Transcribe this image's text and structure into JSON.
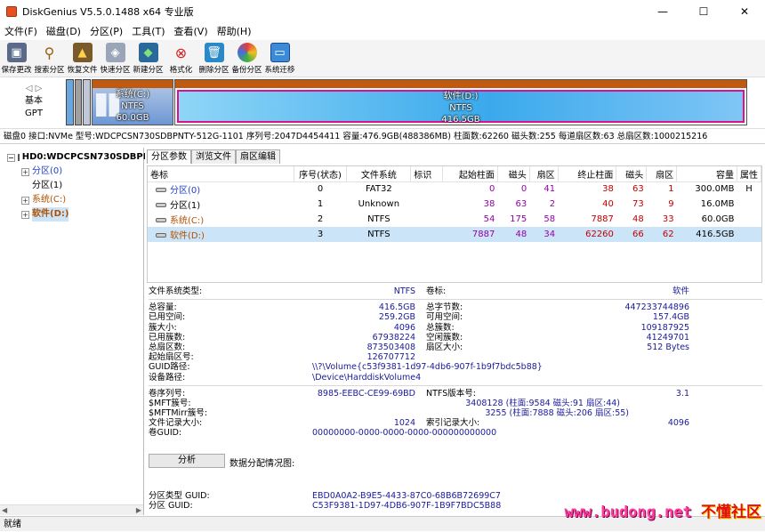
{
  "window": {
    "title": "DiskGenius V5.5.0.1488 x64 专业版",
    "min": "—",
    "max": "☐",
    "close": "✕"
  },
  "menu": [
    "文件(F)",
    "磁盘(D)",
    "分区(P)",
    "工具(T)",
    "查看(V)",
    "帮助(H)"
  ],
  "toolbar": [
    {
      "label": "保存更改",
      "icon": "save-icon"
    },
    {
      "label": "搜索分区",
      "icon": "magnifier-icon"
    },
    {
      "label": "恢复文件",
      "icon": "recover-icon"
    },
    {
      "label": "快速分区",
      "icon": "quick-partition-icon"
    },
    {
      "label": "新建分区",
      "icon": "new-partition-icon"
    },
    {
      "label": "格式化",
      "icon": "format-icon"
    },
    {
      "label": "删除分区",
      "icon": "trash-icon"
    },
    {
      "label": "备份分区",
      "icon": "backup-icon"
    },
    {
      "label": "系统迁移",
      "icon": "migrate-icon"
    }
  ],
  "disk_map": {
    "type_line1": "基本",
    "type_line2": "GPT",
    "part_c": {
      "name": "系统(C:)",
      "fs": "NTFS",
      "size": "60.0GB"
    },
    "part_d": {
      "name": "软件(D:)",
      "fs": "NTFS",
      "size": "416.5GB"
    }
  },
  "disk_info": "磁盘0 接口:NVMe  型号:WDCPCSN730SDBPNTY-512G-1101  序列号:2047D4454411  容量:476.9GB(488386MB)  柱面数:62260  磁头数:255  每道扇区数:63  总扇区数:1000215216",
  "tree": {
    "root": "HD0:WDCPCSN730SDBPNTY-512G",
    "items": [
      "分区(0)",
      "分区(1)",
      "系统(C:)",
      "软件(D:)"
    ]
  },
  "tabs": [
    "分区参数",
    "浏览文件",
    "扇区编辑"
  ],
  "table": {
    "headers": [
      "卷标",
      "序号(状态)",
      "文件系统",
      "标识",
      "起始柱面",
      "磁头",
      "扇区",
      "终止柱面",
      "磁头",
      "扇区",
      "容量",
      "属性"
    ],
    "rows": [
      [
        "分区(0)",
        "0",
        "FAT32",
        "",
        "0",
        "0",
        "41",
        "38",
        "63",
        "1",
        "300.0MB",
        "H"
      ],
      [
        "分区(1)",
        "1",
        "Unknown",
        "",
        "38",
        "63",
        "2",
        "40",
        "73",
        "9",
        "16.0MB",
        ""
      ],
      [
        "系统(C:)",
        "2",
        "NTFS",
        "",
        "54",
        "175",
        "58",
        "7887",
        "48",
        "33",
        "60.0GB",
        ""
      ],
      [
        "软件(D:)",
        "3",
        "NTFS",
        "",
        "7887",
        "48",
        "34",
        "62260",
        "66",
        "62",
        "416.5GB",
        ""
      ]
    ]
  },
  "details": {
    "fs_type_k": "文件系统类型:",
    "fs_type_v": "NTFS",
    "vol_label_k": "卷标:",
    "vol_label_v": "软件",
    "total_k": "总容量:",
    "total_v": "416.5GB",
    "total_bytes_k": "总字节数:",
    "total_bytes_v": "447233744896",
    "used_k": "已用空间:",
    "used_v": "259.2GB",
    "free_k": "可用空间:",
    "free_v": "157.4GB",
    "cluster_k": "簇大小:",
    "cluster_v": "4096",
    "clusters_k": "总簇数:",
    "clusters_v": "109187925",
    "used_clusters_k": "已用簇数:",
    "used_clusters_v": "67938224",
    "free_clusters_k": "空闲簇数:",
    "free_clusters_v": "41249701",
    "sectors_k": "总扇区数:",
    "sectors_v": "873503408",
    "sector_size_k": "扇区大小:",
    "sector_size_v": "512 Bytes",
    "start_sector_k": "起始扇区号:",
    "start_sector_v": "126707712",
    "guid_path_k": "GUID路径:",
    "guid_path_v": "\\\\?\\Volume{c53f9381-1d97-4db6-907f-1b9f7bdc5b88}",
    "device_path_k": "设备路径:",
    "device_path_v": "\\Device\\HarddiskVolume4",
    "serial_k": "卷序列号:",
    "serial_v": "8985-EEBC-CE99-69BD",
    "ntfs_ver_k": "NTFS版本号:",
    "ntfs_ver_v": "3.1",
    "mft_k": "$MFT簇号:",
    "mft_v": "3408128 (柱面:9584 磁头:91 扇区:44)",
    "mftmirr_k": "$MFTMirr簇号:",
    "mftmirr_v": "3255 (柱面:7888 磁头:206 扇区:55)",
    "rec_size_k": "文件记录大小:",
    "rec_size_v": "1024",
    "idx_size_k": "索引记录大小:",
    "idx_size_v": "4096",
    "vol_guid_k": "卷GUID:",
    "vol_guid_v": "00000000-0000-0000-0000-000000000000"
  },
  "analyze_button": "分析",
  "dist_label": "数据分配情况图:",
  "guid": {
    "type_k": "分区类型 GUID:",
    "type_v": "EBD0A0A2-B9E5-4433-87C0-68B6B72699C7",
    "part_k": "分区 GUID:",
    "part_v": "C53F9381-1D97-4DB6-907F-1B9F7BDC5B88"
  },
  "status": "就绪",
  "watermark": {
    "url": "www.budong.net",
    "cn": "不懂社区"
  },
  "colors": {
    "accent_orange": "#c05a10",
    "selected_row": "#cce4f7",
    "partition_border": "#e0108c"
  }
}
